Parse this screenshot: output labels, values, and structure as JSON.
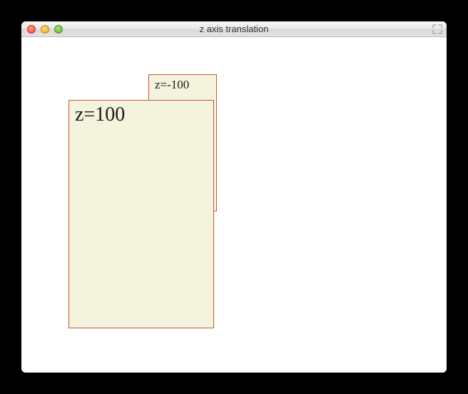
{
  "window": {
    "title": "z axis translation"
  },
  "boxes": {
    "back_label": "z=-100",
    "front_label": "z=100"
  }
}
